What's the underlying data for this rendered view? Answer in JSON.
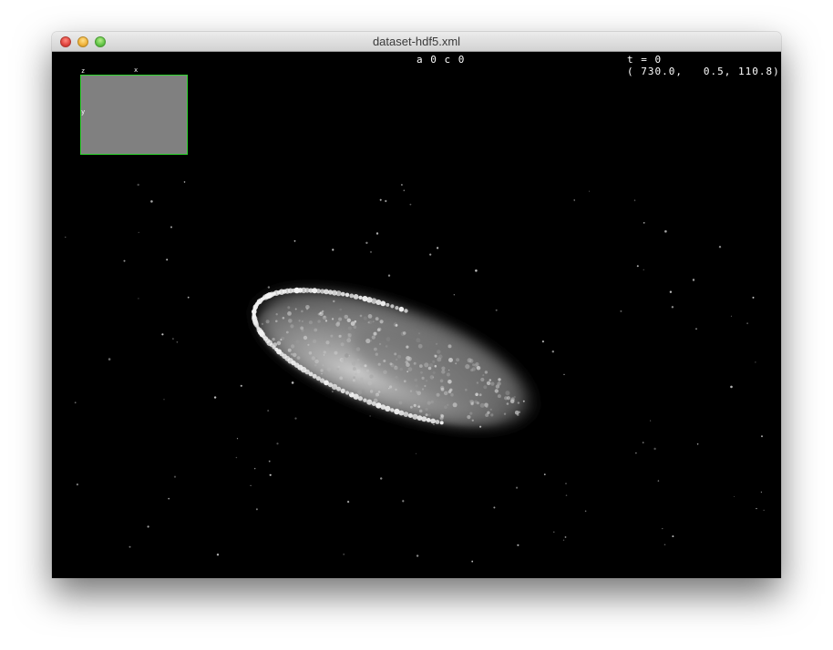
{
  "window": {
    "title": "dataset-hdf5.xml"
  },
  "viewer": {
    "source_info": "a 0 c 0",
    "timepoint": "t = 0",
    "mouse_coordinates": "( 730.0,   0.5, 110.8)",
    "box_overlay": {
      "axis_z": "z",
      "axis_x": "x",
      "axis_y": "y",
      "frame_color": "#2fd62f",
      "fill_color": "#808080"
    }
  }
}
